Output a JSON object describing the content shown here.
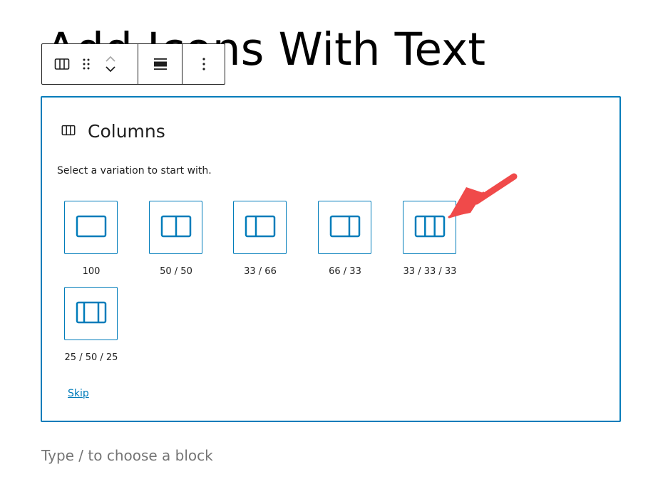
{
  "post_title": "Add Icons With Text",
  "toolbar": {
    "block_type_icon": "columns-icon",
    "drag_icon": "drag-handle-icon",
    "move_up_icon": "chevron-up-icon",
    "move_down_icon": "chevron-down-icon",
    "align_icon": "align-wide-icon",
    "more_icon": "more-vertical-icon"
  },
  "placeholder": {
    "icon": "columns-icon",
    "title": "Columns",
    "instructions": "Select a variation to start with.",
    "variations": [
      {
        "label": "100",
        "icon": "columns-100-icon"
      },
      {
        "label": "50 / 50",
        "icon": "columns-50-50-icon"
      },
      {
        "label": "33 / 66",
        "icon": "columns-33-66-icon"
      },
      {
        "label": "66 / 33",
        "icon": "columns-66-33-icon"
      },
      {
        "label": "33 / 33 / 33",
        "icon": "columns-33-33-33-icon"
      },
      {
        "label": "25 / 50 / 25",
        "icon": "columns-25-50-25-icon"
      }
    ],
    "skip_label": "Skip"
  },
  "appender_placeholder": "Type / to choose a block",
  "colors": {
    "accent": "#007cba",
    "annotation_arrow": "#f04a4a",
    "placeholder_text": "#757575"
  }
}
